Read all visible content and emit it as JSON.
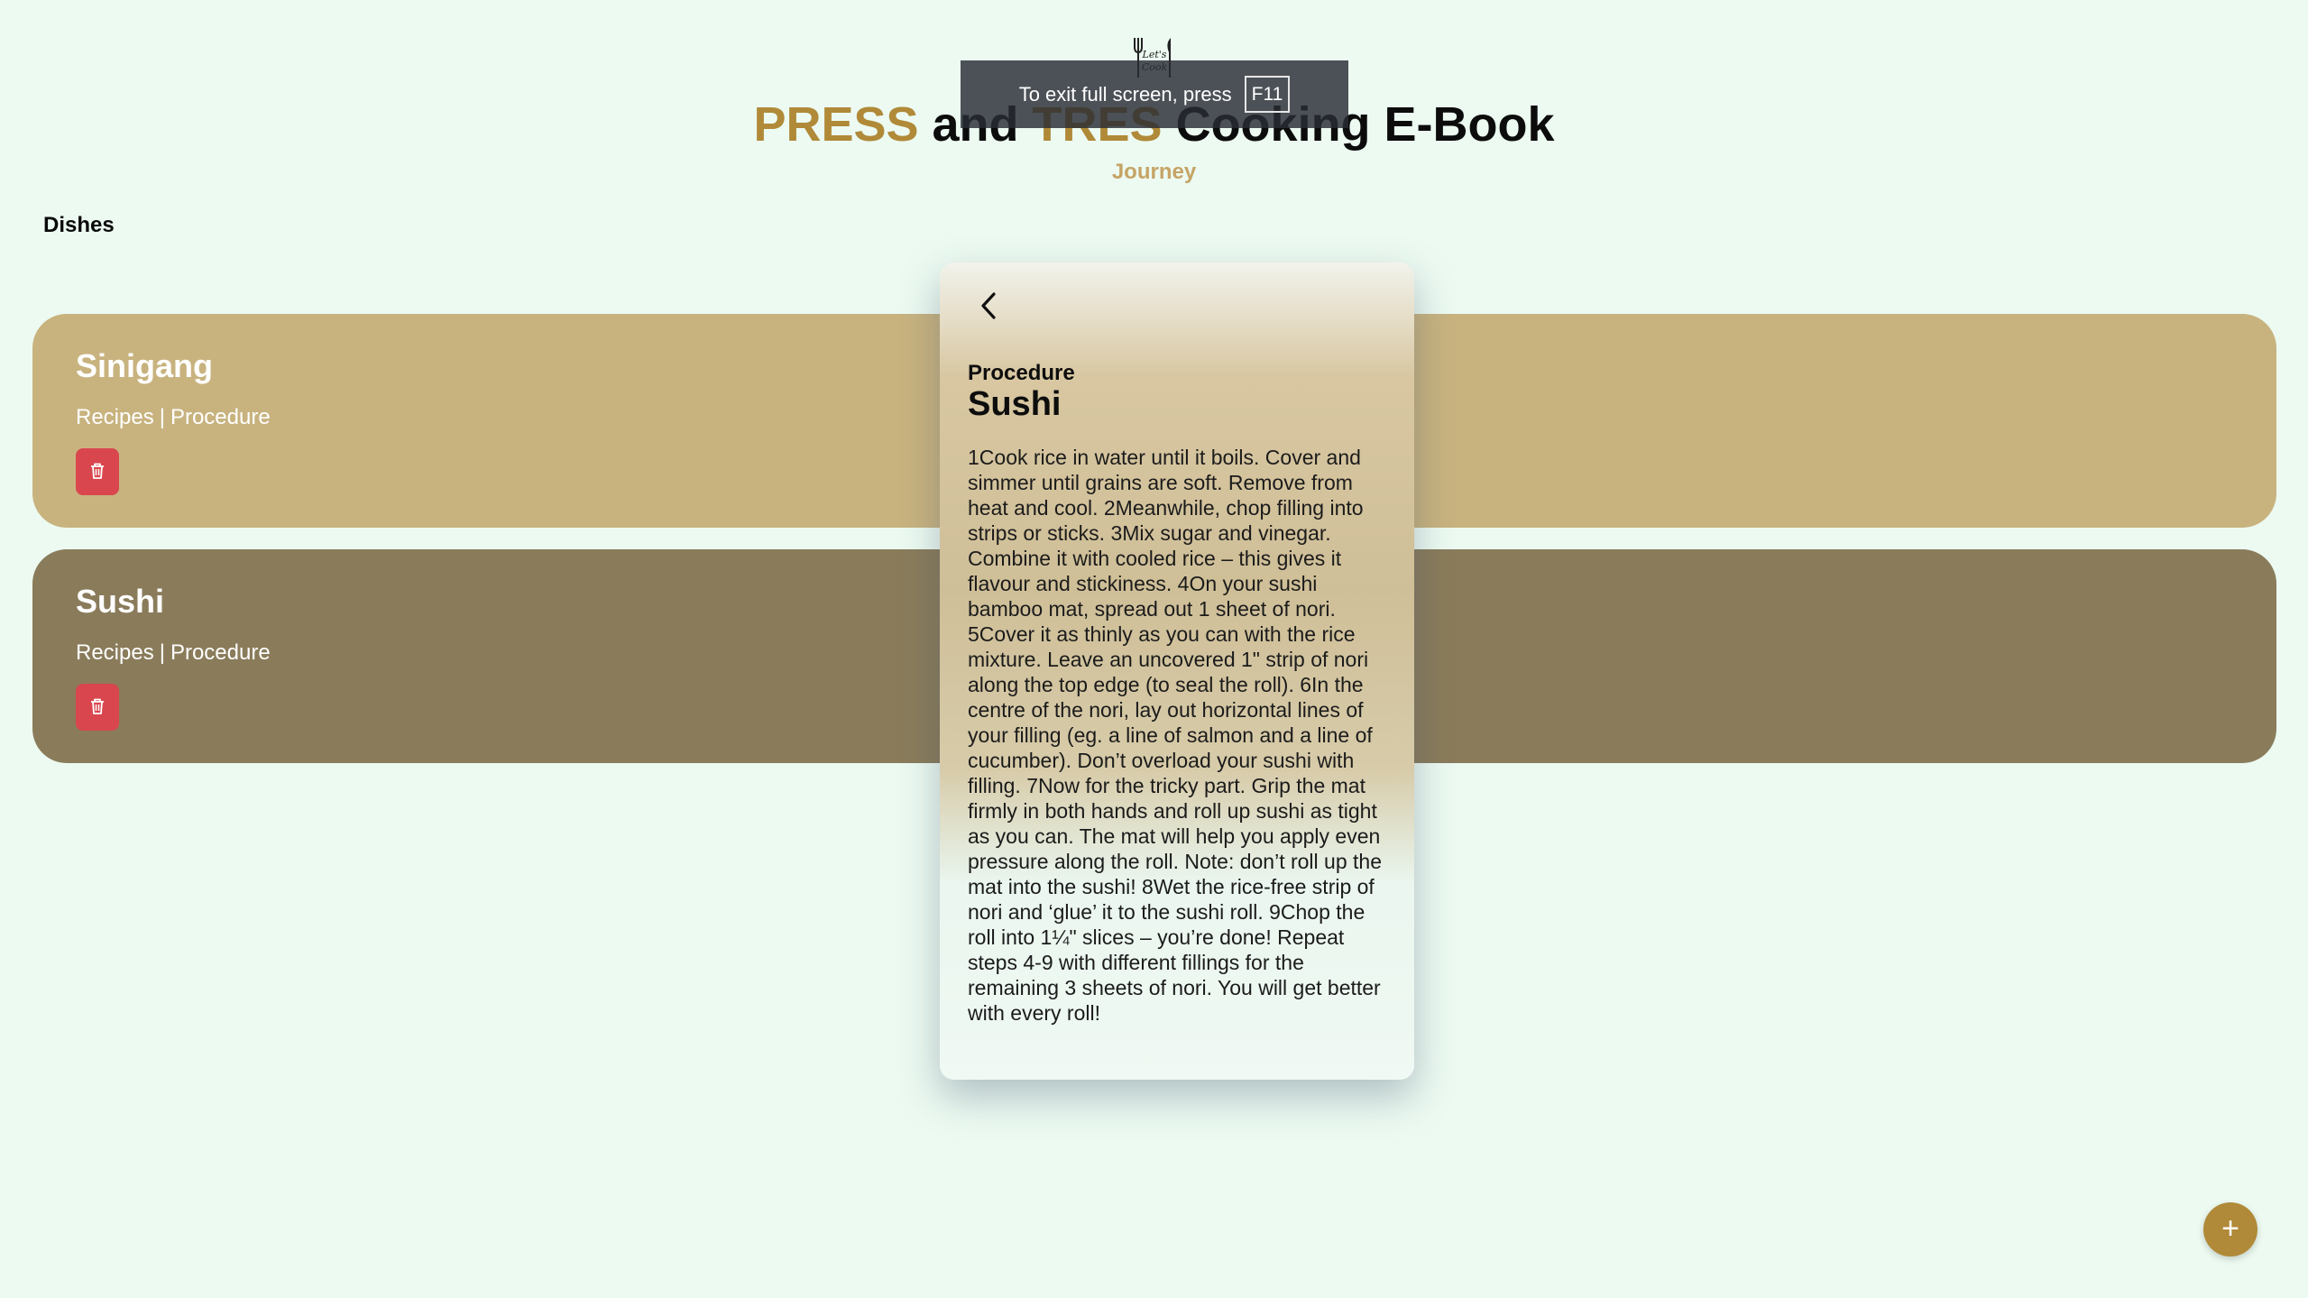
{
  "header": {
    "title_part1": "PRESS",
    "title_part2": " and ",
    "title_part3": "TRES",
    "title_part4": " Cooking E-Book",
    "subtitle": "Journey",
    "logo_text": "Let's Cook"
  },
  "fullscreen_toast": {
    "message": "To exit full screen, press",
    "key": "F11"
  },
  "section": {
    "title": "Dishes"
  },
  "dishes": [
    {
      "name": "Sinigang",
      "recipes_label": "Recipes",
      "separator": "|",
      "procedure_label": "Procedure",
      "delete_icon": "trash-icon",
      "color": "#c8b37f"
    },
    {
      "name": "Sushi",
      "recipes_label": "Recipes",
      "separator": "|",
      "procedure_label": "Procedure",
      "delete_icon": "trash-icon",
      "color": "#8a7c5b"
    }
  ],
  "modal": {
    "back_icon": "chevron-left-icon",
    "label": "Procedure",
    "title": "Sushi",
    "text": "1Cook rice in water until it boils. Cover and simmer until grains are soft. Remove from heat and cool. 2Meanwhile, chop filling into strips or sticks. 3Mix sugar and vinegar. Combine it with cooled rice – this gives it flavour and stickiness. 4On your sushi bamboo mat, spread out 1 sheet of nori. 5Cover it as thinly as you can with the rice mixture. Leave an uncovered 1\" strip of nori along the top edge (to seal the roll). 6In the centre of the nori, lay out horizontal lines of your filling (eg. a line of salmon and a line of cucumber). Don’t overload your sushi with filling. 7Now for the tricky part. Grip the mat firmly in both hands and roll up sushi as tight as you can. The mat will help you apply even pressure along the roll. Note: don’t roll up the mat into the sushi! 8Wet the rice-free strip of nori and ‘glue’ it to the sushi roll. 9Chop the roll into 1¼\" slices – you’re done! Repeat steps 4-9 with different fillings for the remaining 3 sheets of nori. You will get better with every roll!"
  },
  "fab": {
    "label": "+",
    "icon": "plus-icon",
    "color": "#b08a38"
  }
}
